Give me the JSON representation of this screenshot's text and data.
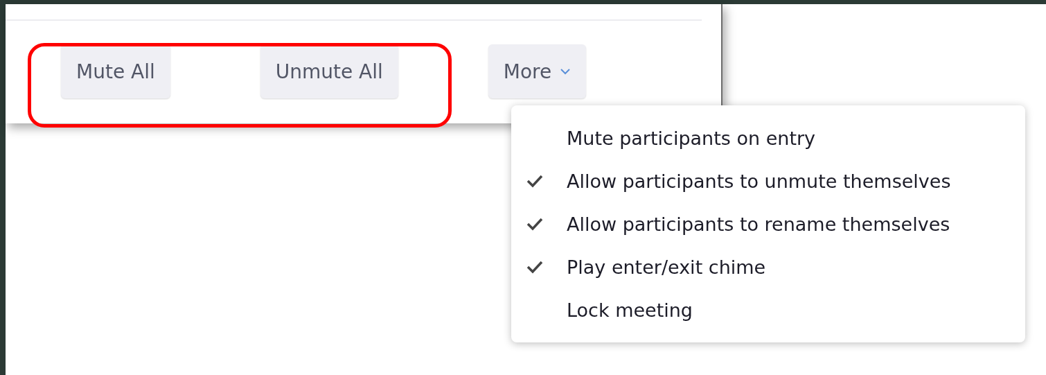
{
  "toolbar": {
    "buttons": [
      {
        "label": "Mute All",
        "kind": "plain"
      },
      {
        "label": "Unmute All",
        "kind": "plain"
      },
      {
        "label": "More",
        "kind": "dropdown"
      }
    ],
    "highlighted": true
  },
  "menu": {
    "items": [
      {
        "label": "Mute participants on entry",
        "checked": false
      },
      {
        "label": "Allow participants to unmute themselves",
        "checked": true
      },
      {
        "label": "Allow participants to rename themselves",
        "checked": true
      },
      {
        "label": "Play enter/exit chime",
        "checked": true
      },
      {
        "label": "Lock meeting",
        "checked": false
      }
    ]
  }
}
